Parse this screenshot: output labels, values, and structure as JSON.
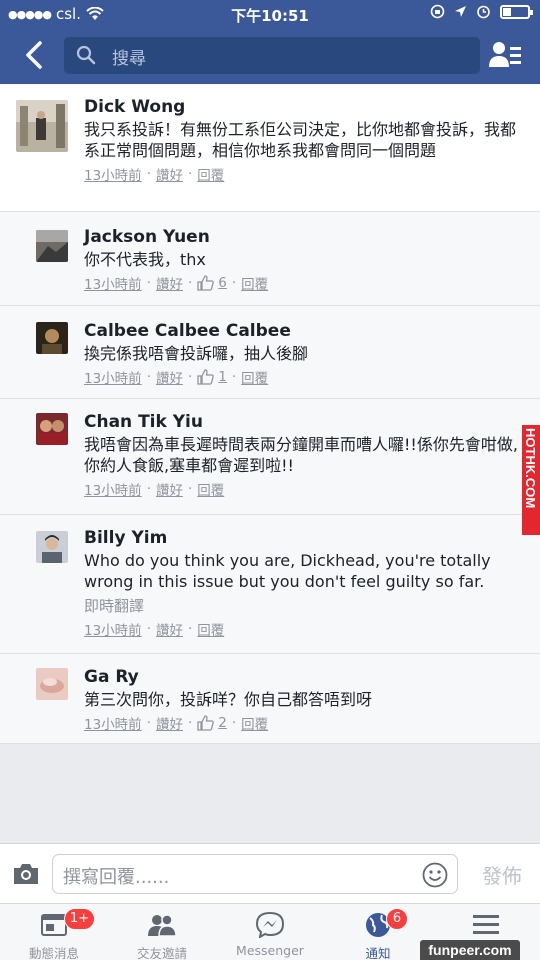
{
  "status": {
    "carrier": "csl.",
    "time": "下午10:51"
  },
  "header": {
    "search_placeholder": "搜尋"
  },
  "comments": [
    {
      "name": "Dick Wong",
      "text": "我只系投訴！有無份工系佢公司決定，比你地都會投訴，我都系正常問個問題，相信你地系我都會問同一個問題",
      "time": "13小時前",
      "like": "讚好",
      "reply": "回覆",
      "likes": ""
    },
    {
      "name": "Jackson Yuen",
      "text": "你不代表我，thx",
      "time": "13小時前",
      "like": "讚好",
      "reply": "回覆",
      "likes": "6"
    },
    {
      "name": "Calbee Calbee Calbee",
      "text": "換完係我唔會投訴囉，抽人後腳",
      "time": "13小時前",
      "like": "讚好",
      "reply": "回覆",
      "likes": "1"
    },
    {
      "name": "Chan Tik Yiu",
      "text": "我唔會因為車長遲時間表兩分鐘開車而嘈人囉!!係你先會咁做,你約人食飯,塞車都會遲到啦!!",
      "time": "13小時前",
      "like": "讚好",
      "reply": "回覆",
      "likes": ""
    },
    {
      "name": "Billy Yim",
      "text": "Who do you think you are, Dickhead, you're totally wrong in this issue but you don't feel guilty so far.",
      "translate": "即時翻譯",
      "time": "13小時前",
      "like": "讚好",
      "reply": "回覆",
      "likes": ""
    },
    {
      "name": "Ga Ry",
      "text": "第三次問你，投訴咩？你自己都答唔到呀",
      "time": "13小時前",
      "like": "讚好",
      "reply": "回覆",
      "likes": "2"
    }
  ],
  "reply_bar": {
    "placeholder": "撰寫回覆......",
    "post_label": "發佈"
  },
  "tabs": [
    {
      "label": "動態消息",
      "badge": "1+",
      "icon": "news-feed-icon"
    },
    {
      "label": "交友邀請",
      "badge": "",
      "icon": "friend-requests-icon"
    },
    {
      "label": "Messenger",
      "badge": "",
      "icon": "messenger-icon"
    },
    {
      "label": "通知",
      "badge": "6",
      "icon": "globe-notifications-icon"
    },
    {
      "label": "",
      "badge": "",
      "icon": "menu-icon"
    }
  ],
  "watermarks": {
    "side": "HOTHK.COM",
    "corner": "funpeer.com"
  },
  "colors": {
    "header": "#3b5998",
    "badge": "#fa3e3e",
    "link_gray": "#90949c"
  }
}
